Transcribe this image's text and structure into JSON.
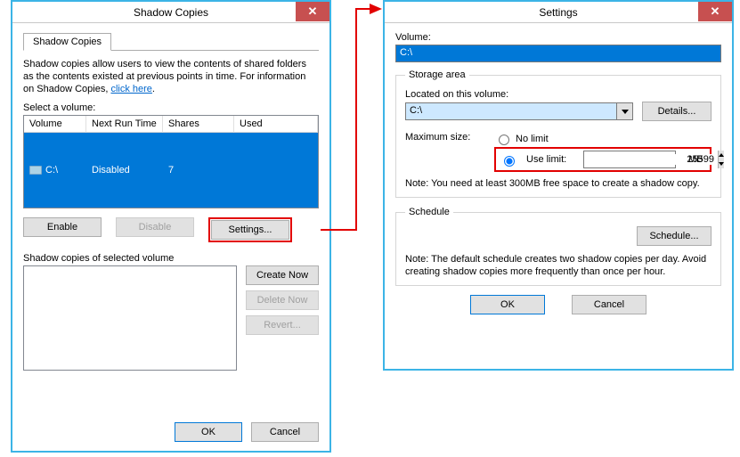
{
  "shadow": {
    "title": "Shadow Copies",
    "tab_label": "Shadow Copies",
    "info_text_1": "Shadow copies allow users to view the contents of shared folders as the contents existed at previous points in time. For information on Shadow Copies, ",
    "info_link": "click here",
    "info_text_2": ".",
    "select_label": "Select a volume:",
    "headers": {
      "volume": "Volume",
      "next": "Next Run Time",
      "shares": "Shares",
      "used": "Used"
    },
    "rows": [
      {
        "volume": "C:\\",
        "next": "Disabled",
        "shares": "7",
        "used": ""
      }
    ],
    "enable": "Enable",
    "disable": "Disable",
    "settings": "Settings...",
    "copies_label": "Shadow copies of selected volume",
    "create_now": "Create Now",
    "delete_now": "Delete Now",
    "revert": "Revert...",
    "ok": "OK",
    "cancel": "Cancel"
  },
  "settings": {
    "title": "Settings",
    "volume_label": "Volume:",
    "volume_value": "C:\\",
    "storage_legend": "Storage area",
    "located_label": "Located on this volume:",
    "located_value": "C:\\",
    "details": "Details...",
    "max_label": "Maximum size:",
    "no_limit": "No limit",
    "use_limit": "Use limit:",
    "limit_value": "25599",
    "limit_unit": "MB",
    "storage_note": "Note: You need at least 300MB free space to create a shadow copy.",
    "schedule_legend": "Schedule",
    "schedule_btn": "Schedule...",
    "schedule_note": "Note: The default schedule creates two shadow copies per day. Avoid creating shadow copies more frequently than once per hour.",
    "ok": "OK",
    "cancel": "Cancel"
  }
}
